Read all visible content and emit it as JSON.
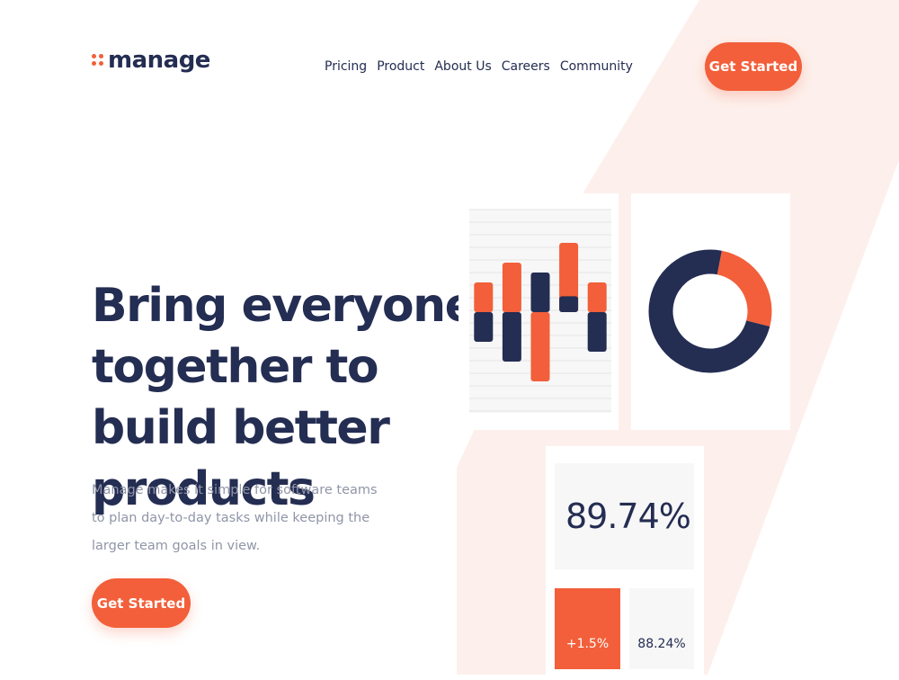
{
  "brand": {
    "logo_text": "manage",
    "accent_color": "#f25f3a",
    "navy_color": "#242d52",
    "tint_color": "#fdf0ec"
  },
  "nav": {
    "items": [
      {
        "label": "Pricing"
      },
      {
        "label": "Product"
      },
      {
        "label": "About Us"
      },
      {
        "label": "Careers"
      },
      {
        "label": "Community"
      }
    ]
  },
  "header": {
    "cta_label": "Get Started"
  },
  "hero": {
    "title": "Bring everyone together to build better products",
    "description": "Manage makes it simple for software teams to plan day-to-day tasks while keeping the larger team goals in view.",
    "cta_label": "Get Started"
  },
  "chart_data": [
    {
      "type": "bar",
      "title": "",
      "grid": true,
      "series": [
        {
          "color": "#f25f3a",
          "values": [
            1.5,
            2.5,
            -3.5,
            3.5,
            1.5
          ]
        },
        {
          "color": "#242d52",
          "values": [
            -1.5,
            -2.5,
            2.0,
            0.8,
            -2.0
          ]
        }
      ],
      "categories": [
        "",
        "",
        "",
        "",
        ""
      ]
    },
    {
      "type": "pie",
      "title": "",
      "series": [
        {
          "color": "#f25f3a",
          "value": 26
        },
        {
          "color": "#242d52",
          "value": 74
        }
      ]
    }
  ],
  "stats": {
    "main": "89.74%",
    "change": "+1.5%",
    "secondary": "88.24%"
  }
}
